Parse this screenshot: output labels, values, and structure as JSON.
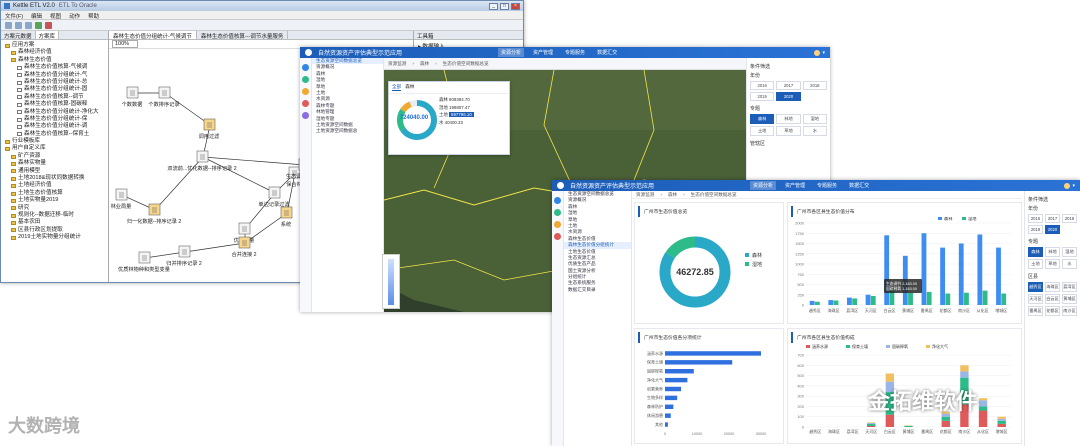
{
  "etl": {
    "title": "Kettle ETL V2.0",
    "title_extra": "ETL To Oracle",
    "menu": [
      "文件(F)",
      "编辑",
      "视图",
      "动作",
      "帮助"
    ],
    "tree_tabs": [
      "方案元数据",
      "方案库"
    ],
    "tree": [
      "应用方案",
      "森林经济价值",
      "森林生态价值",
      "森林生态价值核算-气候调",
      "森林生态价值分组统计-气",
      "森林生态价值分组统计-总",
      "森林生态价值分组统计-固",
      "森林生态价值核算--调节",
      "森林生态价值核算-固碳释",
      "森林生态价值分组统计-净化大",
      "森林生态价值分组统计-保",
      "森林生态价值分组统计-调",
      "森林生态价值核算--保育土",
      "行业模板库",
      "用户自定义库",
      "矿产资源",
      "森林实物量",
      "通用模型",
      "土地2018&现状同数据转换",
      "土地经济价值",
      "土地生态价值核算",
      "土地实物量2019",
      "研究",
      "规则化--数据迁移-临时",
      "基本农田",
      "区县行政区划提取",
      "2019土地实物量分组统计"
    ],
    "canvas_tabs": [
      "森林生态价值分组统计-气候调节",
      "森林生态价值核算---调节水量服务"
    ],
    "zoom": "100%",
    "flow_nodes": [
      "个数数据",
      "个数排序记录",
      "调用过滤",
      "双流前...优化数据--排序记录 2",
      "林业局量",
      "归一化数据--排序记录 2",
      "单边记录过滤",
      "保合林",
      "系统",
      "生态调节服务器",
      "优化数量",
      "合并连接 2",
      "归并排序记录 2",
      "优质林物种和类型变量"
    ],
    "right_pane": {
      "title": "工具箱",
      "item": "数据输入"
    }
  },
  "map_dashboard": {
    "system_name": "自然资源资产评估典型示范应用",
    "nav": [
      "资源分析",
      "资产管理",
      "专题服务",
      "数据汇交"
    ],
    "menu": [
      "生态资源空间数据总览",
      "资源概况",
      "森林",
      "湿地",
      "草地",
      "土地",
      "水资源",
      "森林专题",
      "林地管理",
      "湿地专题",
      "土地资源空间数据",
      "土地资源空间数据总"
    ],
    "crumbs": [
      "资源监测",
      "森林",
      "生态价值空间数据总览"
    ],
    "popup": {
      "tabs": [
        "全部",
        "森林"
      ],
      "total": "724040.00",
      "legend": [
        {
          "label": "森林",
          "value": "809394.70"
        },
        {
          "label": "湿地",
          "value": "199807.47"
        },
        {
          "label": "土地",
          "value": "597796.10"
        },
        {
          "label": "水",
          "value": "40400.33"
        }
      ]
    },
    "years": [
      "2016",
      "2017",
      "2018",
      "2019",
      "2020"
    ],
    "filter": {
      "title": "条件筛选",
      "group_year": "年份",
      "group_type": "专题",
      "types": [
        "森林",
        "林地",
        "湿地",
        "土地",
        "草地",
        "水"
      ],
      "group_level": "管辖区"
    }
  },
  "chart_dashboard": {
    "system_name": "自然资源资产评估典型示范应用",
    "nav": [
      "资源分析",
      "资产管理",
      "专题服务",
      "数据汇交"
    ],
    "menu": [
      "生态资源空间数据总览",
      "资源概况",
      "森林",
      "湿地",
      "草地",
      "土地",
      "水资源",
      "森林生态价值",
      "森林生态价值分组统计",
      "土地生态价值",
      "生态资源汇总",
      "优质生态产品",
      "国土资源分析",
      "分组统计",
      "生态系统服务",
      "数据汇交目录"
    ],
    "crumbs": [
      "资源监测",
      "森林",
      "生态价值空间数据总览"
    ],
    "card_donut_title": "广州市生态价值总览",
    "card_bar_title": "广州市各区县生态价值分布",
    "card_hbar_title": "广州市生态价值各分项统计",
    "card_stack_title": "广州市各区县生态价值构成",
    "filter": {
      "title": "条件筛选",
      "group_year": "年份",
      "group_type": "专题",
      "group_level": "区县"
    },
    "tooltip": [
      "生态调节 2,183.00",
      "固碳释氧 1,183.00"
    ]
  },
  "chart_data": [
    {
      "type": "pie",
      "title": "广州市生态价值总览",
      "labels": [
        "森林",
        "湿地"
      ],
      "values": [
        39000,
        7272.85
      ],
      "center_value": "46272.85",
      "colors": [
        "#2aa8c8",
        "#2dbb8a"
      ]
    },
    {
      "type": "bar",
      "title": "广州市各区县生态价值分布",
      "categories": [
        "越秀区",
        "海珠区",
        "荔湾区",
        "天河区",
        "白云区",
        "黄埔区",
        "番禺区",
        "花都区",
        "南沙区",
        "从化区",
        "增城区"
      ],
      "series": [
        {
          "name": "森林",
          "values": [
            100,
            120,
            180,
            250,
            1700,
            1200,
            1750,
            1400,
            1500,
            1720,
            1400
          ]
        },
        {
          "name": "湿地",
          "values": [
            80,
            110,
            160,
            220,
            450,
            300,
            320,
            280,
            300,
            350,
            280
          ]
        }
      ],
      "ylim": [
        0,
        2000
      ],
      "yticks": [
        0,
        250,
        500,
        750,
        1000,
        1250,
        1500,
        1750,
        2000
      ]
    },
    {
      "type": "bar",
      "orientation": "horizontal",
      "title": "广州市生态价值各分项统计",
      "categories": [
        "涵养水源",
        "保育土壤",
        "固碳释氧",
        "净化大气",
        "积累营养",
        "生物多样",
        "森林防护",
        "休闲游憩",
        "其他"
      ],
      "values": [
        30000,
        21000,
        9000,
        7000,
        5000,
        3800,
        2600,
        1800,
        900
      ],
      "xlim": [
        0,
        35000
      ],
      "xticks": [
        0,
        5000,
        10000,
        15000,
        20000,
        25000,
        30000,
        35000
      ],
      "color": "#2f6fe0"
    },
    {
      "type": "bar",
      "stacked": true,
      "title": "广州市各区县生态价值构成",
      "categories": [
        "越秀区",
        "海珠区",
        "荔湾区",
        "天河区",
        "白云区",
        "黄埔区",
        "番禺区",
        "花都区",
        "南沙区",
        "从化区",
        "增城区"
      ],
      "series": [
        {
          "name": "涵养水源",
          "values": [
            0,
            0,
            0,
            10,
            120,
            0,
            0,
            60,
            220,
            160,
            30
          ]
        },
        {
          "name": "保育土壤",
          "values": [
            0,
            0,
            0,
            20,
            220,
            10,
            0,
            40,
            260,
            40,
            30
          ]
        },
        {
          "name": "固碳释氧",
          "values": [
            0,
            0,
            0,
            10,
            100,
            0,
            0,
            30,
            60,
            60,
            20
          ]
        },
        {
          "name": "净化大气",
          "values": [
            0,
            0,
            0,
            5,
            80,
            5,
            0,
            20,
            60,
            20,
            20
          ]
        }
      ],
      "ylim": [
        0,
        700
      ],
      "yticks": [
        0,
        100,
        200,
        300,
        400,
        500,
        600,
        700
      ]
    }
  ],
  "watermarks": {
    "left": "大数跨境",
    "right": "金拓维软件"
  },
  "colors": {
    "brand_blue": "#1c5db8",
    "teal": "#2dbb8a",
    "cyan": "#2aa8c8"
  }
}
